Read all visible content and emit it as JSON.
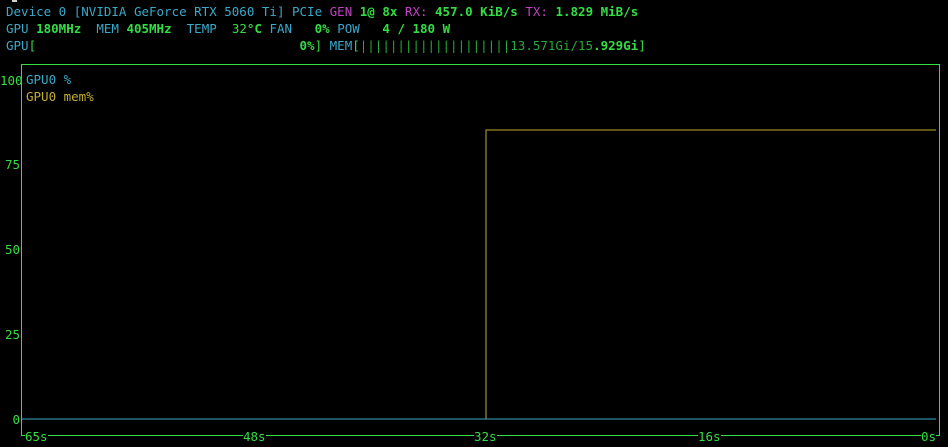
{
  "device_line": {
    "prefix": "Device 0 [",
    "name": "NVIDIA GeForce RTX 5060 Ti",
    "suffix": "]",
    "pcie_label": "PCIe",
    "gen_label": "GEN",
    "gen_value": "1@ 8x",
    "rx_label": "RX:",
    "rx_value": "457.0 KiB/s",
    "tx_label": "TX:",
    "tx_value": "1.829 MiB/s"
  },
  "stats_line": {
    "gpu_label": "GPU",
    "gpu_clock": "180MHz",
    "mem_label": "MEM",
    "mem_clock": "405MHz",
    "temp_label": "TEMP",
    "temp_value": "32",
    "temp_unit": "°C",
    "fan_label": "FAN",
    "fan_value": "0%",
    "pow_label": "POW",
    "pow_value": "4 / 180 W"
  },
  "usage_line": {
    "gpu_label": "GPU",
    "gpu_open": "[",
    "gpu_pct": "0%",
    "gpu_close": "]",
    "mem_label": "MEM",
    "mem_open": "[",
    "mem_bars": "||||||||||||||||||||",
    "mem_used": "13.571Gi",
    "mem_sep": "/",
    "mem_total_dim": "15",
    "mem_total_bright": ".929Gi",
    "mem_close": "]"
  },
  "chart_data": {
    "type": "line",
    "title": "",
    "xlabel": "",
    "ylabel": "",
    "ylim": [
      0,
      100
    ],
    "xlim": [
      65,
      0
    ],
    "y_ticks": [
      "100",
      "75",
      "50",
      "25",
      "0"
    ],
    "x_ticks": [
      "65s",
      "48s",
      "32s",
      "16s",
      "0s"
    ],
    "legend_position": "top-left",
    "series": [
      {
        "name": "GPU0 %",
        "color": "#3aa8c8",
        "x": [
          65,
          0
        ],
        "y": [
          0,
          0
        ]
      },
      {
        "name": "GPU0 mem%",
        "color": "#c2ad30",
        "x": [
          65,
          32,
          32,
          0
        ],
        "y": [
          0,
          0,
          85,
          85
        ]
      }
    ]
  }
}
